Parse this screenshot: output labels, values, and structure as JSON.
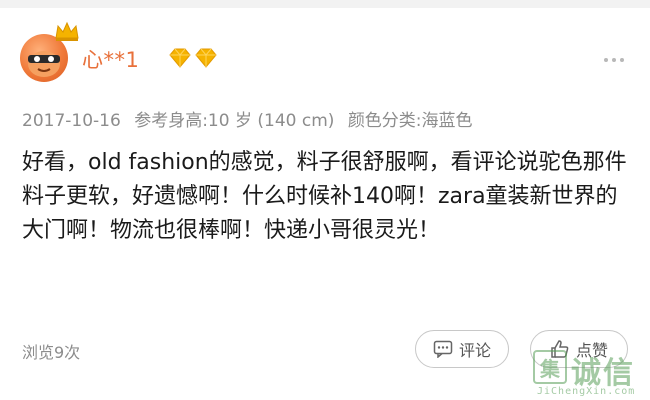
{
  "user": {
    "name": "心**1"
  },
  "meta": {
    "date": "2017-10-16",
    "height": "参考身高:10 岁 (140 cm)",
    "color": "颜色分类:海蓝色"
  },
  "review": {
    "text": "好看，old fashion的感觉，料子很舒服啊，看评论说驼色那件料子更软，好遗憾啊！什么时候补140啊！zara童装新世界的大门啊！物流也很棒啊！快递小哥很灵光！"
  },
  "footer": {
    "views": "浏览9次",
    "comment_label": "评论",
    "like_label": "点赞"
  },
  "watermark": {
    "logo": "集",
    "text": "诚信",
    "url": "JiChengXin.com"
  },
  "colors": {
    "username": "#e8703a",
    "meta": "#8c8c8c",
    "gem": "#f5b300",
    "watermark": "#5aa05a"
  },
  "icons": {
    "avatar_badge": "crown-icon",
    "gems": "diamond-icon",
    "more": "more-dots-icon",
    "comment": "comment-icon",
    "like": "thumb-up-icon"
  }
}
